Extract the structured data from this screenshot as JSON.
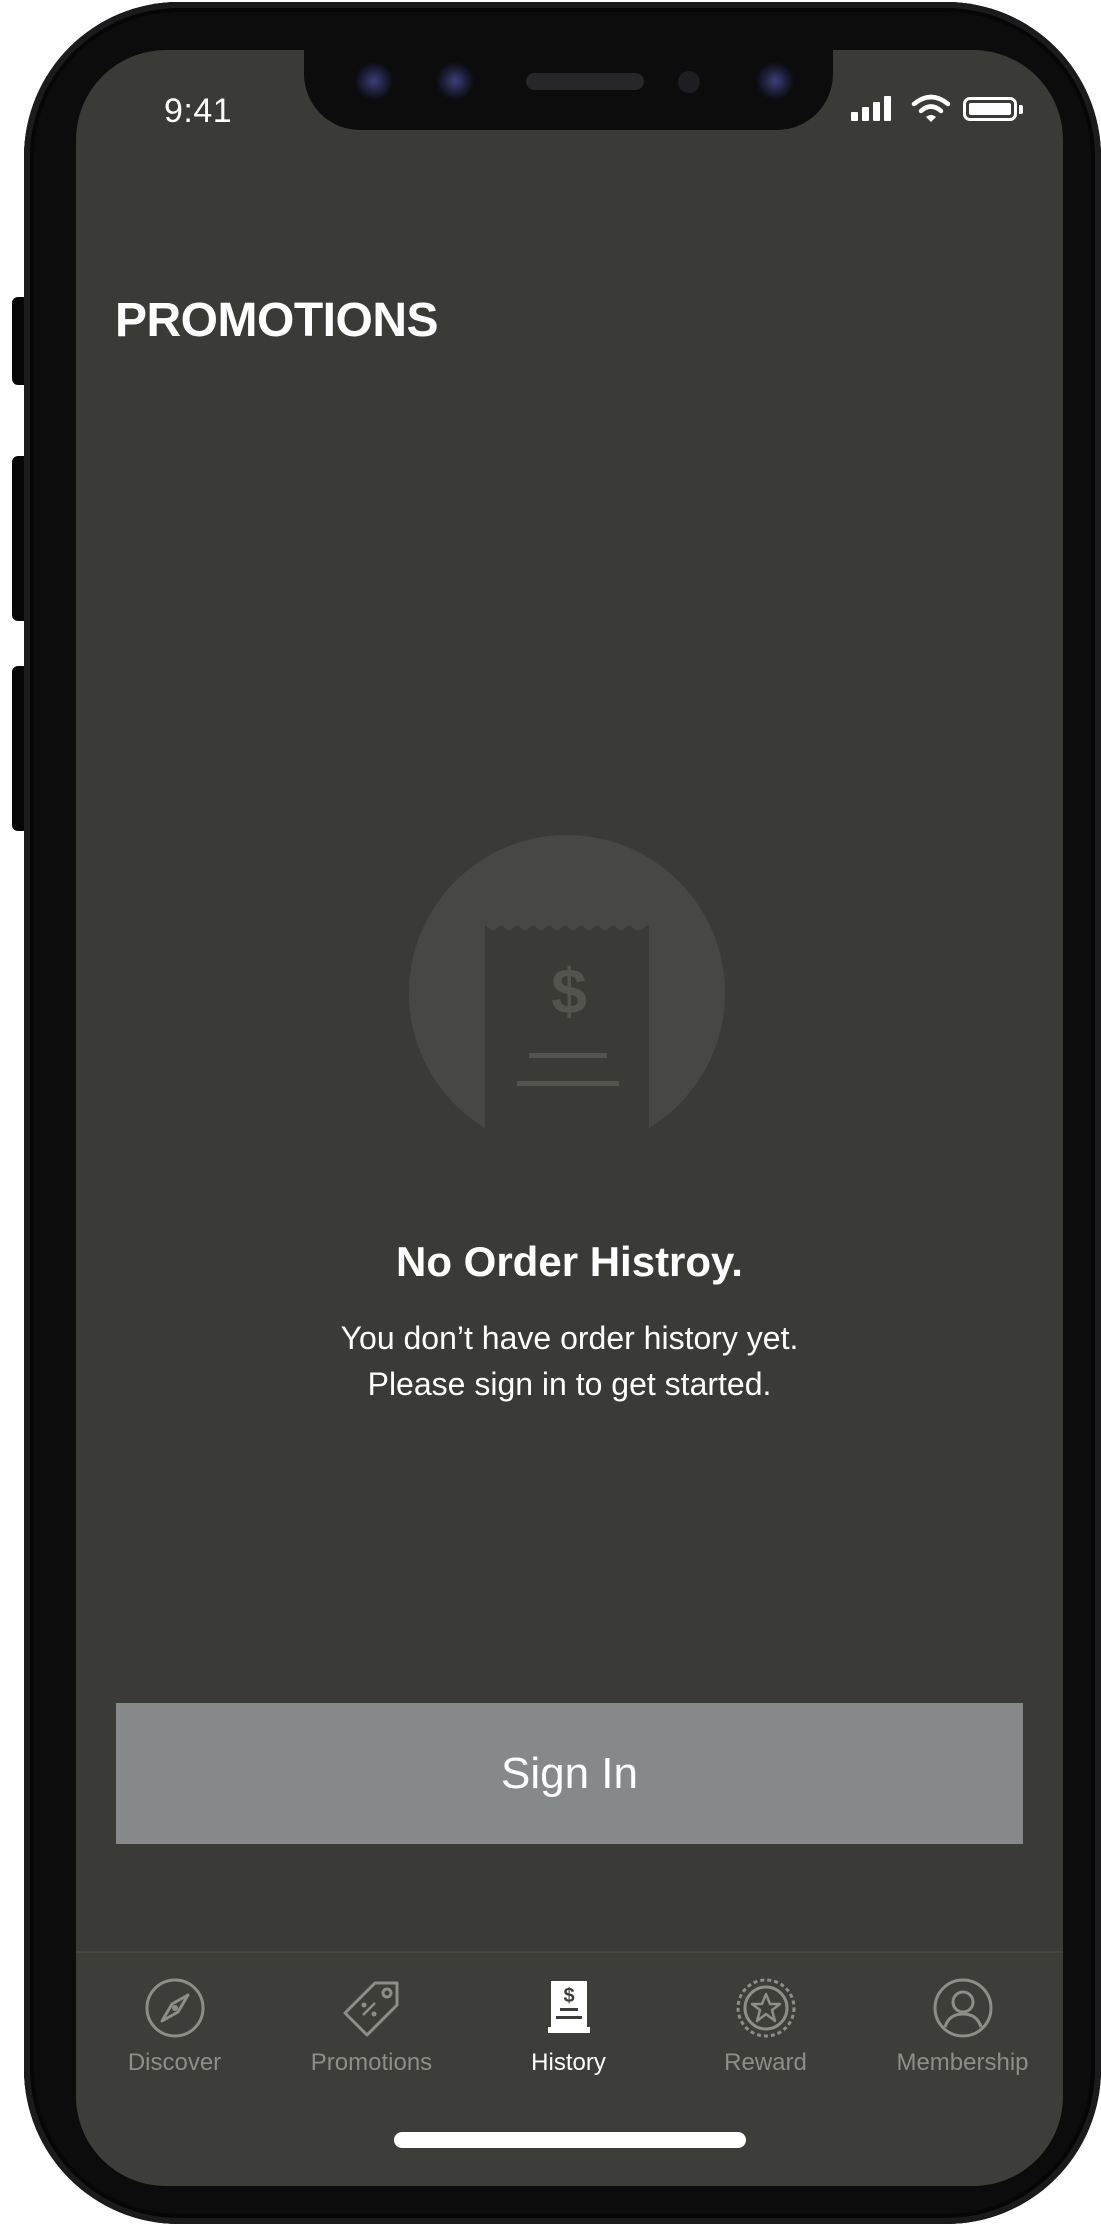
{
  "status_bar": {
    "time": "9:41"
  },
  "header": {
    "title": "PROMOTIONS"
  },
  "empty_state": {
    "illustration_icon": "receipt-dollar-icon",
    "title": "No Order Histroy.",
    "message_line_1": "You don’t have order history yet.",
    "message_line_2": "Please sign in to get started."
  },
  "sign_in": {
    "label": "Sign In"
  },
  "tab_bar": {
    "active_tab": "History",
    "items": [
      {
        "label": "Discover",
        "icon": "compass-icon"
      },
      {
        "label": "Promotions",
        "icon": "tag-icon"
      },
      {
        "label": "History",
        "icon": "receipt-icon"
      },
      {
        "label": "Reward",
        "icon": "star-badge-icon"
      },
      {
        "label": "Membership",
        "icon": "user-circle-icon"
      }
    ]
  },
  "colors": {
    "screen_background": "#3a3a36",
    "button_background": "#858989",
    "inactive_tab_label": "#8e8e88",
    "active_tab_label": "#ffffff",
    "illustration_circle": "#474743"
  }
}
